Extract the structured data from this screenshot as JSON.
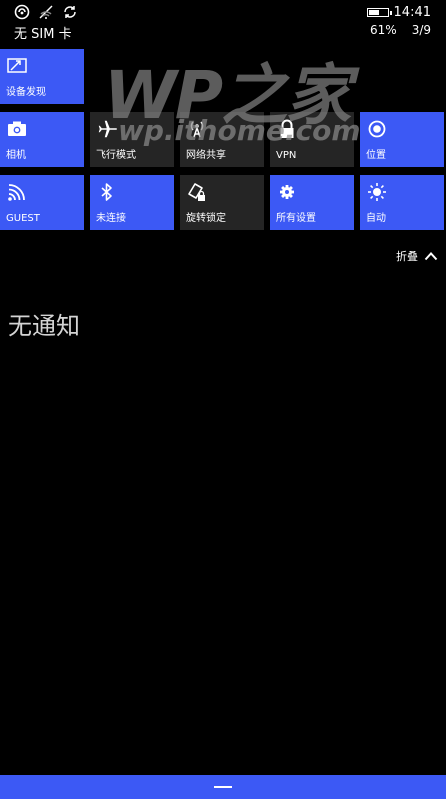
{
  "status_bar": {
    "carrier": "无 SIM 卡",
    "time": "14:41",
    "battery_percent": "61%",
    "battery_level": 0.61,
    "page_indicator": "3/9",
    "icons": [
      "nfc-icon",
      "no-signal-icon",
      "rotation-lock-status-icon"
    ]
  },
  "tiles": [
    {
      "label": "设备发现",
      "icon": "project-screen-icon",
      "state": "on"
    },
    {
      "label": "相机",
      "icon": "camera-icon",
      "state": "on"
    },
    {
      "label": "飞行模式",
      "icon": "airplane-icon",
      "state": "off"
    },
    {
      "label": "网络共享",
      "icon": "hotspot-icon",
      "state": "off"
    },
    {
      "label": "VPN",
      "icon": "lock-icon",
      "state": "off"
    },
    {
      "label": "位置",
      "icon": "location-icon",
      "state": "on"
    },
    {
      "label": "GUEST",
      "icon": "wifi-icon",
      "state": "on"
    },
    {
      "label": "未连接",
      "icon": "bluetooth-icon",
      "state": "on"
    },
    {
      "label": "旋转锁定",
      "icon": "rotation-lock-icon",
      "state": "off"
    },
    {
      "label": "所有设置",
      "icon": "gear-icon",
      "state": "on"
    },
    {
      "label": "自动",
      "icon": "brightness-icon",
      "state": "on"
    }
  ],
  "watermark": {
    "title": "WP之家",
    "url": "wp.ithome.com"
  },
  "collapse_label": "折叠",
  "notifications": {
    "empty_text": "无通知"
  },
  "colors": {
    "accent": "#3c59f5",
    "tile_off": "#252525",
    "background": "#000000"
  }
}
